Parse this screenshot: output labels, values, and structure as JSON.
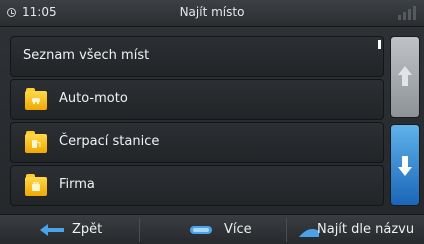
{
  "status": {
    "time": "11:05",
    "title": "Najít místo"
  },
  "list": {
    "items": [
      {
        "label": "Seznam všech míst",
        "icon": null
      },
      {
        "label": "Auto-moto",
        "icon": "car-folder-icon"
      },
      {
        "label": "Čerpací stanice",
        "icon": "fuel-folder-icon"
      },
      {
        "label": "Firma",
        "icon": "business-folder-icon"
      }
    ]
  },
  "colors": {
    "accent_blue": "#2a86d4",
    "folder_yellow": "#f5b800",
    "background": "#2a2d30"
  },
  "bottom": {
    "back_label": "Zpět",
    "more_label": "Více",
    "search_label": "Najít dle názvu"
  }
}
